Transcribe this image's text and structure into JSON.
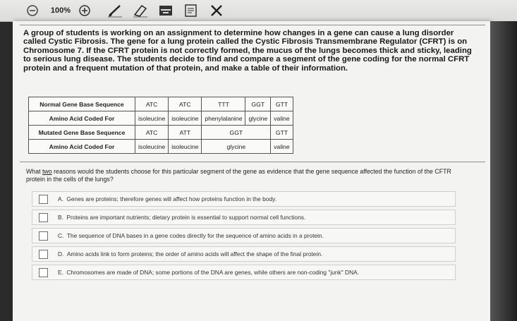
{
  "toolbar": {
    "zoom_level": "100%",
    "icons": [
      "collapse-icon",
      "zoom-in-icon",
      "pen-icon",
      "eraser-icon",
      "keyboard-icon",
      "notes-icon",
      "cross-out-icon"
    ]
  },
  "passage": {
    "text": "A group of students is working on an assignment to determine how changes in a gene can cause a lung disorder called Cystic Fibrosis. The gene for a lung protein called the Cystic Fibrosis Transmembrane Regulator (CFRT) is on Chromosome 7. If the CFRT protein is not correctly formed, the mucus of the lungs becomes thick and sticky, leading to serious lung disease. The students decide to find and compare a segment of the gene coding for the normal CFRT protein and a frequent mutation of that protein, and make a table of their information."
  },
  "table": {
    "rows": [
      {
        "header": "Normal Gene Base Sequence",
        "cells": [
          "ATC",
          "ATC",
          "TTT",
          "GGT",
          "GTT"
        ]
      },
      {
        "header": "Amino Acid Coded For",
        "cells": [
          "isoleucine",
          "isoleucine",
          "phenylalanine",
          "glycine",
          "valine"
        ]
      },
      {
        "header": "Mutated Gene Base Sequence",
        "cells": [
          "ATC",
          "ATT",
          "GGT",
          "GTT"
        ]
      },
      {
        "header": "Amino Acid Coded For",
        "cells": [
          "isoleucine",
          "isoleucine",
          "glycine",
          "valine"
        ]
      }
    ]
  },
  "question": {
    "prefix": "What ",
    "emphasis": "two",
    "suffix": " reasons would the students choose for this particular segment of the gene as evidence that the gene sequence affected the function of the CFTR protein in the cells of the lungs?"
  },
  "choices": [
    {
      "letter": "A.",
      "text": "Genes are proteins; therefore genes will affect how proteins function in the body."
    },
    {
      "letter": "B.",
      "text": "Proteins are important nutrients; dietary protein is essential to support normal cell functions."
    },
    {
      "letter": "C.",
      "text": "The sequence of DNA bases in a gene codes directly for the sequence of amino acids in a protein."
    },
    {
      "letter": "D.",
      "text": "Amino acids link to form proteins; the order of amino acids will affect the shape of the final protein."
    },
    {
      "letter": "E.",
      "text": "Chromosomes are made of DNA; some portions of the DNA are genes, while others are non-coding \"junk\" DNA."
    }
  ]
}
